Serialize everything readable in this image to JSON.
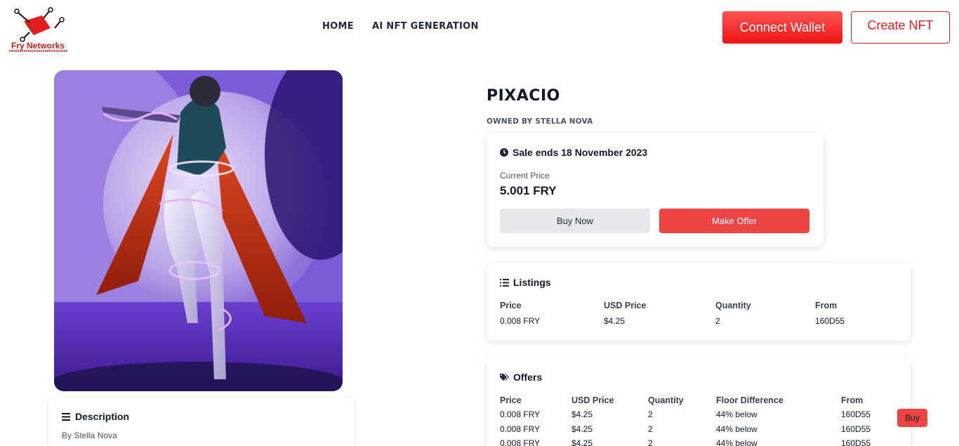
{
  "brand": {
    "name": "Fry Networks"
  },
  "nav": {
    "items": [
      {
        "label": "HOME"
      },
      {
        "label": "AI NFT GENERATION"
      }
    ]
  },
  "header": {
    "connect_label": "Connect Wallet",
    "create_label": "Create NFT"
  },
  "item": {
    "title": "PIXACIO",
    "owner": "OWNED BY STELLA NOVA"
  },
  "description": {
    "title": "Description",
    "by": "By Stella Nova"
  },
  "sale": {
    "ends": "Sale ends 18 November 2023",
    "current_price_label": "Current Price",
    "current_price": "5.001 FRY",
    "buy_label": "Buy Now",
    "offer_label": "Make Offer"
  },
  "listings": {
    "title": "Listings",
    "headers": [
      "Price",
      "USD Price",
      "Quantity",
      "From"
    ],
    "rows": [
      [
        "0.008 FRY",
        "$4.25",
        "2",
        "160D55"
      ]
    ]
  },
  "offers": {
    "title": "Offers",
    "headers": [
      "Price",
      "USD Price",
      "Quantity",
      "Floor Difference",
      "From"
    ],
    "rows": [
      [
        "0.008 FRY",
        "$4.25",
        "2",
        "44% below",
        "160D55"
      ],
      [
        "0.008 FRY",
        "$4.25",
        "2",
        "44% below",
        "160D55"
      ],
      [
        "0.008 FRY",
        "$4.25",
        "2",
        "44% below",
        "160D55"
      ]
    ],
    "buy_label": "Buy"
  },
  "colors": {
    "accent": "#ef4444",
    "brand_red": "#c81e1e"
  }
}
